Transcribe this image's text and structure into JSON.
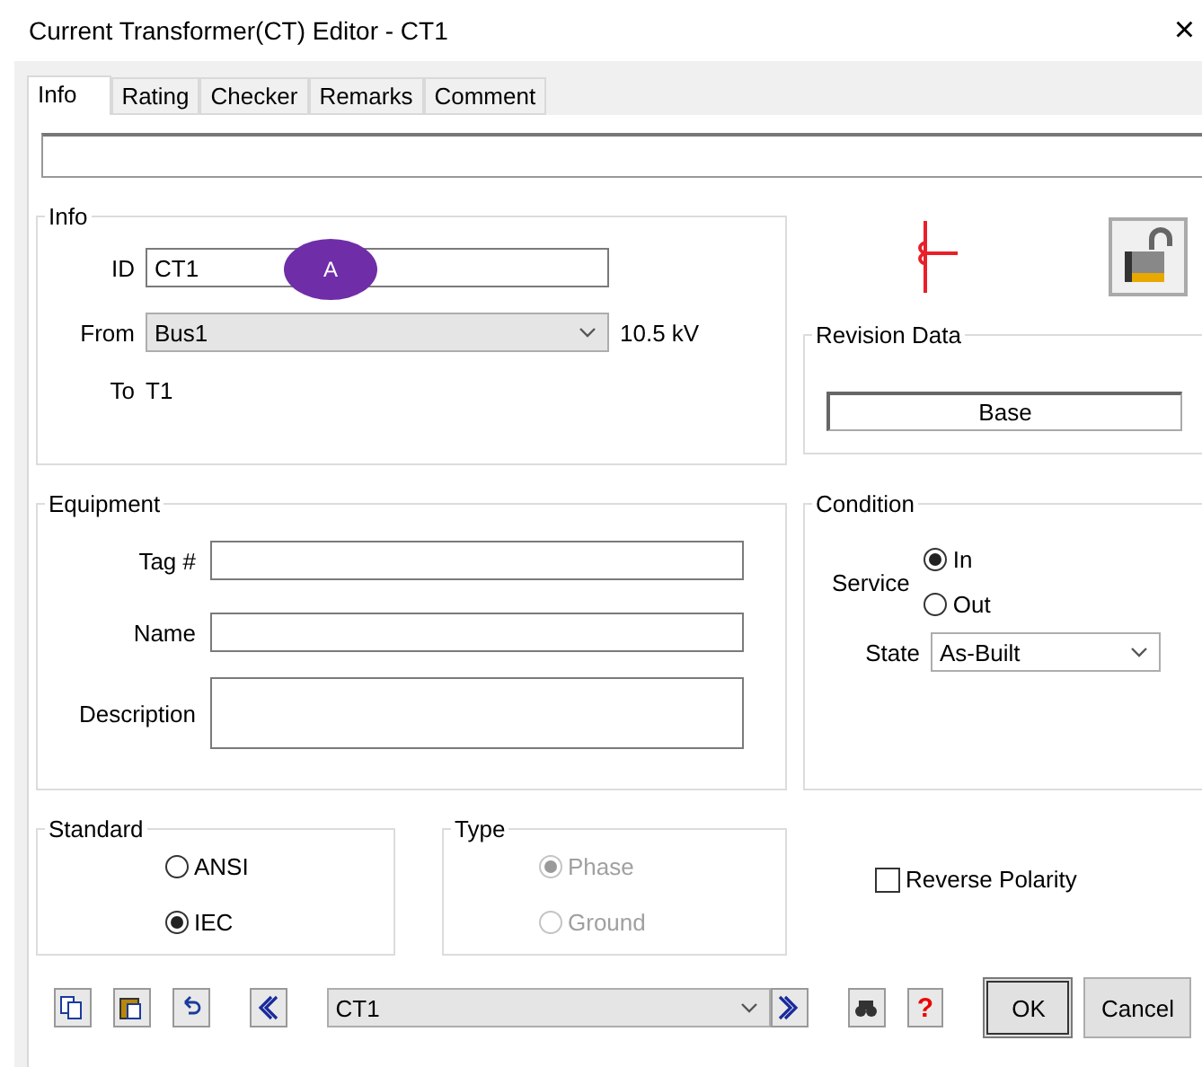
{
  "window": {
    "title": "Current Transformer(CT) Editor - CT1",
    "close": "×"
  },
  "tabs": [
    {
      "label": "Info",
      "selected": true
    },
    {
      "label": "Rating",
      "selected": false
    },
    {
      "label": "Checker",
      "selected": false
    },
    {
      "label": "Remarks",
      "selected": false
    },
    {
      "label": "Comment",
      "selected": false
    }
  ],
  "info": {
    "title": "Info",
    "id_label": "ID",
    "id_value": "CT1",
    "badge": "A",
    "from_label": "From",
    "from_value": "Bus1",
    "voltage": "10.5 kV",
    "to_label": "To",
    "to_value": "T1"
  },
  "lock": {
    "locked": false
  },
  "revision": {
    "title": "Revision Data",
    "value": "Base"
  },
  "equipment": {
    "title": "Equipment",
    "fields": [
      {
        "label": "Tag #",
        "kind": "line"
      },
      {
        "label": "Name",
        "kind": "line"
      },
      {
        "label": "Description",
        "kind": "area"
      }
    ]
  },
  "condition": {
    "title": "Condition",
    "service_label": "Service",
    "service": [
      {
        "label": "In",
        "selected": true
      },
      {
        "label": "Out",
        "selected": false
      }
    ],
    "state_label": "State",
    "state_value": "As-Built"
  },
  "standard": {
    "title": "Standard",
    "options": [
      {
        "label": "ANSI",
        "selected": false
      },
      {
        "label": "IEC",
        "selected": true
      }
    ]
  },
  "type": {
    "title": "Type",
    "disabled": true,
    "options": [
      {
        "label": "Phase",
        "selected": true
      },
      {
        "label": "Ground",
        "selected": false
      }
    ]
  },
  "reverse_polarity": {
    "label": "Reverse Polarity",
    "checked": false
  },
  "footer": {
    "element": "CT1",
    "ok": "OK",
    "cancel": "Cancel",
    "help": "?"
  }
}
